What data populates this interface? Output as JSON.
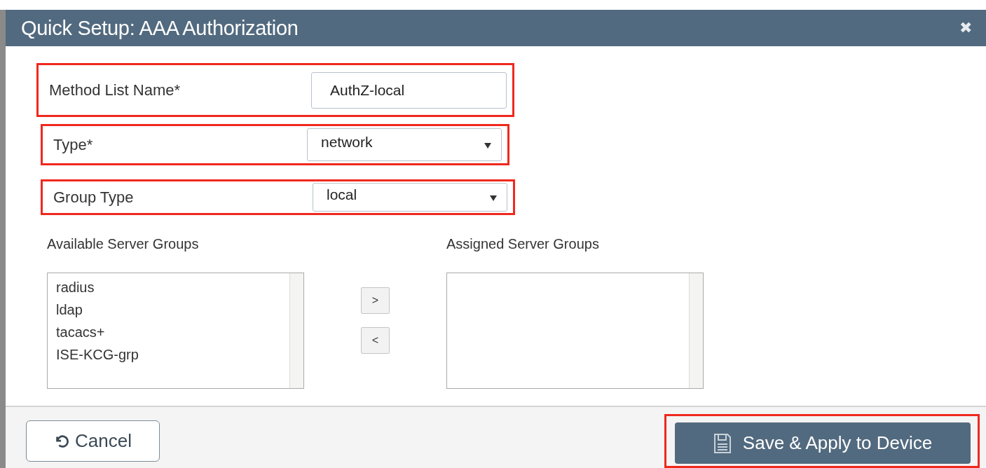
{
  "dialog": {
    "title": "Quick Setup: AAA Authorization",
    "close": "✖"
  },
  "fields": [
    {
      "kind": "text",
      "label": "Method List Name*",
      "value": "AuthZ-local",
      "highlighted": true
    },
    {
      "kind": "select",
      "label": "Type*",
      "value": "network",
      "highlighted": true
    },
    {
      "kind": "select",
      "label": "Group Type",
      "value": "local",
      "highlighted": true
    }
  ],
  "available_server_groups": {
    "label": "Available Server Groups",
    "items": [
      "radius",
      "ldap",
      "tacacs+",
      "ISE-KCG-grp"
    ]
  },
  "move_buttons": [
    ">",
    "<"
  ],
  "assigned_server_groups": {
    "label": "Assigned Server Groups"
  },
  "footer": {
    "cancel": "Cancel",
    "save": {
      "label": "Save & Apply to Device",
      "highlighted": true
    }
  }
}
